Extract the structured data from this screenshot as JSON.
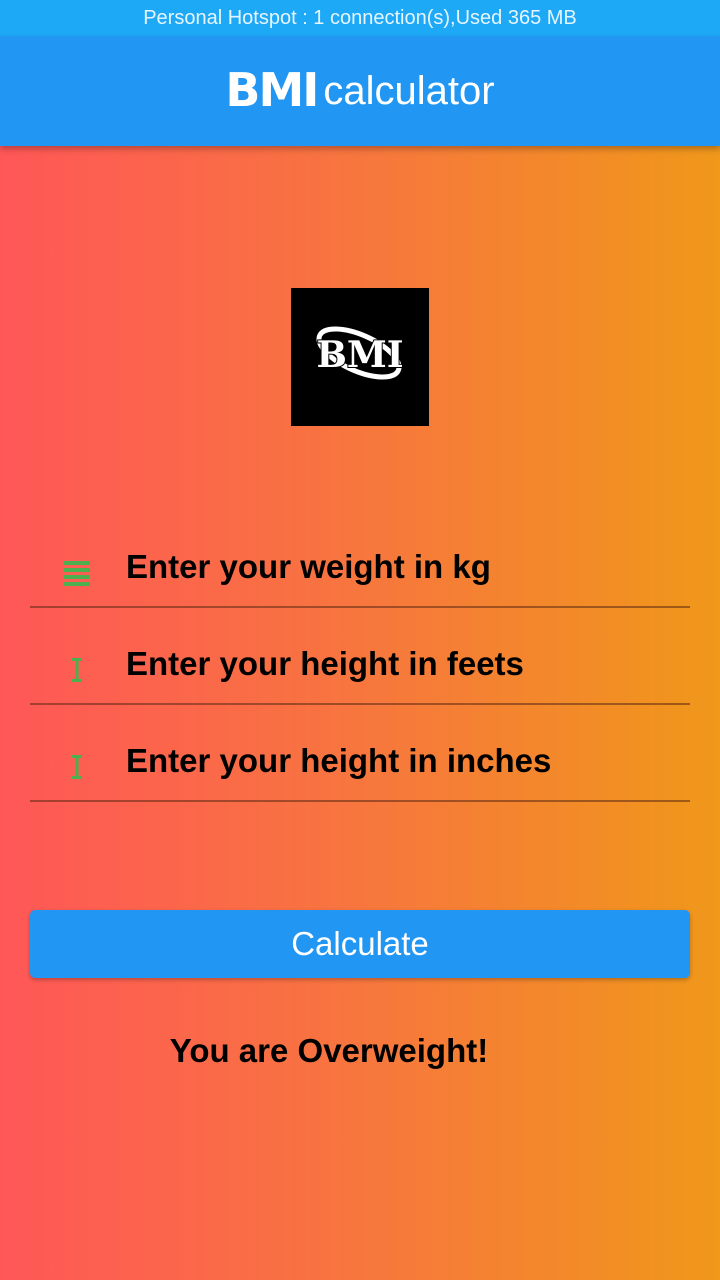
{
  "status_bar": {
    "text": "Personal Hotspot : 1 connection(s),Used  365 MB"
  },
  "app_bar": {
    "title_bold": "BMI",
    "title_light": "calculator"
  },
  "logo": {
    "text": "BMI"
  },
  "form": {
    "weight": {
      "placeholder": "Enter your weight in kg",
      "value": "",
      "icon": "weight-lines-icon"
    },
    "height_feet": {
      "placeholder": "Enter your height in feets",
      "value": "",
      "icon": "vertical-arrows-icon"
    },
    "height_inches": {
      "placeholder": "Enter your height in inches",
      "value": "",
      "icon": "vertical-arrows-icon"
    }
  },
  "calculate_button": {
    "label": "Calculate"
  },
  "result": {
    "text": "You are Overweight!"
  },
  "colors": {
    "status_bar": "#1ea9f7",
    "app_bar": "#2196f3",
    "button": "#2196f3",
    "icon": "#4caf50",
    "gradient_start": "#ff5757",
    "gradient_end": "#f0981a"
  }
}
